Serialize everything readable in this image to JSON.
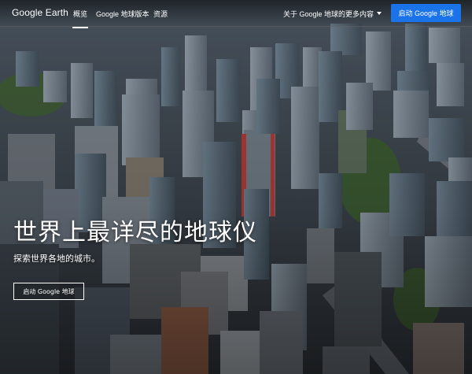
{
  "header": {
    "logo_text": "Google Earth",
    "nav": [
      {
        "label": "概览",
        "active": true
      },
      {
        "label": "Google 地球版本",
        "active": false
      },
      {
        "label": "资源",
        "active": false
      }
    ],
    "more_menu_label": "关于 Google 地球的更多内容",
    "cta_label": "启动 Google 地球"
  },
  "hero": {
    "headline": "世界上最详尽的地球仪",
    "subheadline": "探索世界各地的城市。",
    "cta_label": "启动 Google 地球"
  },
  "colors": {
    "accent": "#1a73e8",
    "text_on_image": "#ffffff"
  },
  "icons": {
    "more_menu_caret": "caret-down-icon"
  }
}
